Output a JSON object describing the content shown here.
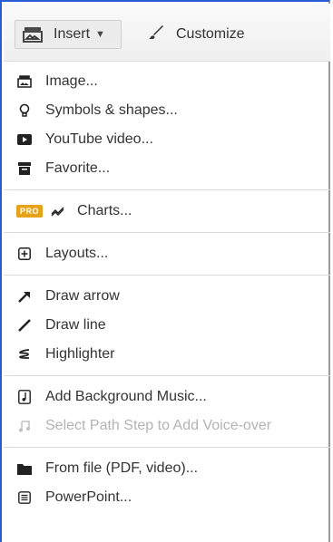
{
  "toolbar": {
    "insert_label": "Insert",
    "customize_label": "Customize"
  },
  "menu": {
    "group1": [
      {
        "label": "Image...",
        "icon": "image-icon"
      },
      {
        "label": "Symbols & shapes...",
        "icon": "lightbulb-icon"
      },
      {
        "label": "YouTube video...",
        "icon": "youtube-icon"
      },
      {
        "label": "Favorite...",
        "icon": "archive-box-icon"
      }
    ],
    "charts": {
      "badge": "PRO",
      "label": "Charts...",
      "icon": "chart-line-icon"
    },
    "layouts": {
      "label": "Layouts...",
      "icon": "plus-box-icon"
    },
    "group3": [
      {
        "label": "Draw arrow",
        "icon": "arrow-icon"
      },
      {
        "label": "Draw line",
        "icon": "line-icon"
      },
      {
        "label": "Highlighter",
        "icon": "highlighter-icon"
      }
    ],
    "group4": [
      {
        "label": "Add Background Music...",
        "icon": "music-file-icon"
      },
      {
        "label": "Select Path Step to Add Voice-over",
        "icon": "music-note-icon",
        "disabled": true
      }
    ],
    "group5": [
      {
        "label": "From file (PDF, video)...",
        "icon": "folder-icon"
      },
      {
        "label": "PowerPoint...",
        "icon": "list-box-icon"
      }
    ]
  },
  "colors": {
    "frame_accent": "#2a5bd7",
    "pro_badge": "#e6a31a"
  }
}
